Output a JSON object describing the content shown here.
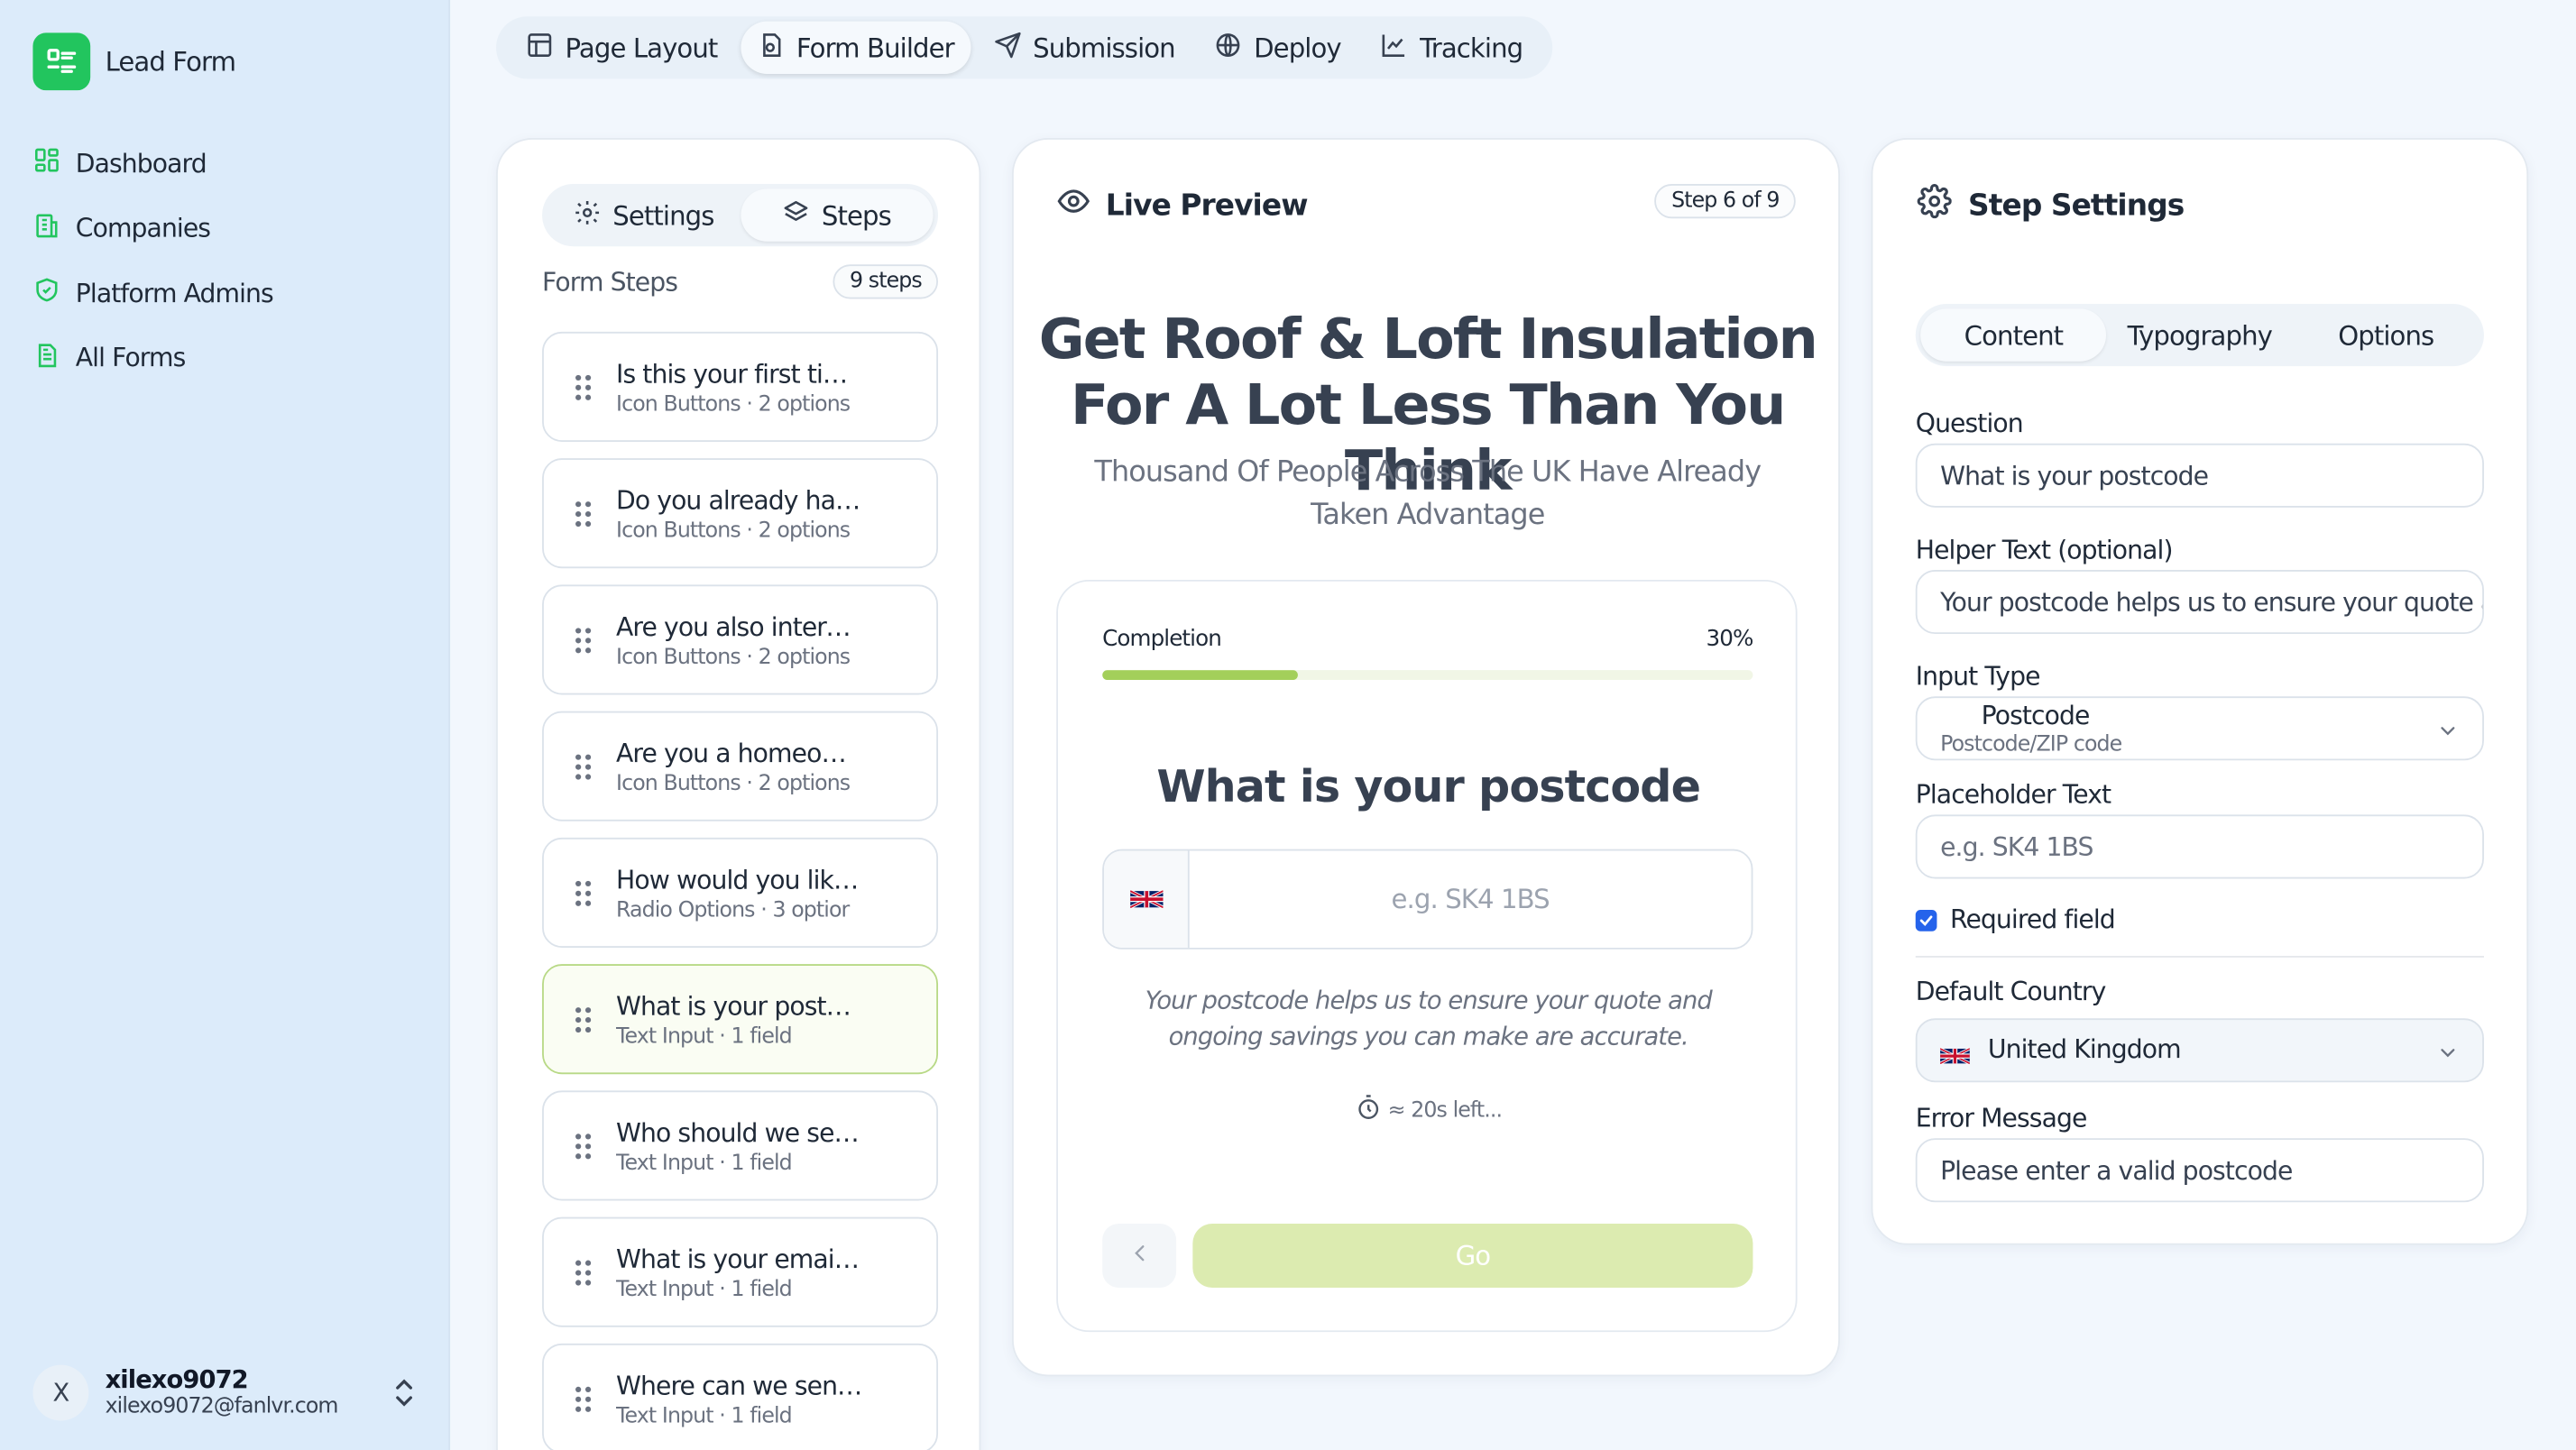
{
  "app": {
    "name": "Lead Form"
  },
  "sidebar": {
    "items": [
      {
        "label": "Dashboard",
        "icon": "dashboard-icon"
      },
      {
        "label": "Companies",
        "icon": "building-icon"
      },
      {
        "label": "Platform Admins",
        "icon": "shield-icon"
      },
      {
        "label": "All Forms",
        "icon": "document-icon"
      }
    ],
    "user": {
      "initial": "X",
      "name": "xilexo9072",
      "email": "xilexo9072@fanlvr.com"
    }
  },
  "topnav": {
    "tabs": [
      {
        "label": "Page Layout",
        "active": false
      },
      {
        "label": "Form Builder",
        "active": true
      },
      {
        "label": "Submission",
        "active": false
      },
      {
        "label": "Deploy",
        "active": false
      },
      {
        "label": "Tracking",
        "active": false
      }
    ]
  },
  "steps_panel": {
    "toggle": {
      "settings": "Settings",
      "steps": "Steps"
    },
    "title": "Form Steps",
    "count": "9 steps",
    "steps": [
      {
        "title": "Is this your first tim…",
        "sub": "Icon Buttons · 2 options"
      },
      {
        "title": "Do you already ha…",
        "sub": "Icon Buttons · 2 options"
      },
      {
        "title": "Are you also intere…",
        "sub": "Icon Buttons · 2 options"
      },
      {
        "title": "Are you a homeow…",
        "sub": "Icon Buttons · 2 options"
      },
      {
        "title": "How would you lik…",
        "sub": "Radio Options · 3 optior"
      },
      {
        "title": "What is your postc…",
        "sub": "Text Input · 1 field"
      },
      {
        "title": "Who should we se…",
        "sub": "Text Input · 1 field"
      },
      {
        "title": "What is your email …",
        "sub": "Text Input · 1 field"
      },
      {
        "title": "Where can we sen…",
        "sub": "Text Input · 1 field"
      }
    ],
    "active_index": 5
  },
  "preview": {
    "title": "Live Preview",
    "step_badge": "Step 6 of 9",
    "headline": "Get Roof & Loft Insulation For A Lot Less Than You Think",
    "subheadline": "Thousand Of People Across The UK Have Already Taken Advantage",
    "completion_label": "Completion",
    "completion_pct": "30%",
    "completion_fraction": 0.3,
    "question": "What is your postcode",
    "input_placeholder": "e.g. SK4 1BS",
    "helper": "Your postcode helps us to ensure your quote and ongoing savings you can make are accurate.",
    "time_left": "≈ 20s left...",
    "go_label": "Go"
  },
  "step_settings": {
    "title": "Step Settings",
    "tabs": [
      {
        "label": "Content",
        "active": true
      },
      {
        "label": "Typography",
        "active": false
      },
      {
        "label": "Options",
        "active": false
      }
    ],
    "question_label": "Question",
    "question_value": "What is your postcode",
    "helper_label": "Helper Text (optional)",
    "helper_value": "Your postcode helps us to ensure your quote and ongoing savings you can make are accurate.",
    "input_type_label": "Input Type",
    "input_type_value": "Postcode",
    "input_type_desc": "Postcode/ZIP code",
    "placeholder_label": "Placeholder Text",
    "placeholder_value": "e.g. SK4 1BS",
    "required_label": "Required field",
    "required_checked": true,
    "country_label": "Default Country",
    "country_value": "United Kingdom",
    "error_label": "Error Message",
    "error_value": "Please enter a valid postcode"
  },
  "colors": {
    "brand": "#22c55e",
    "accent_bar": "#a3cf5a",
    "go_button": "#dcebb0",
    "checkbox": "#2563eb"
  }
}
